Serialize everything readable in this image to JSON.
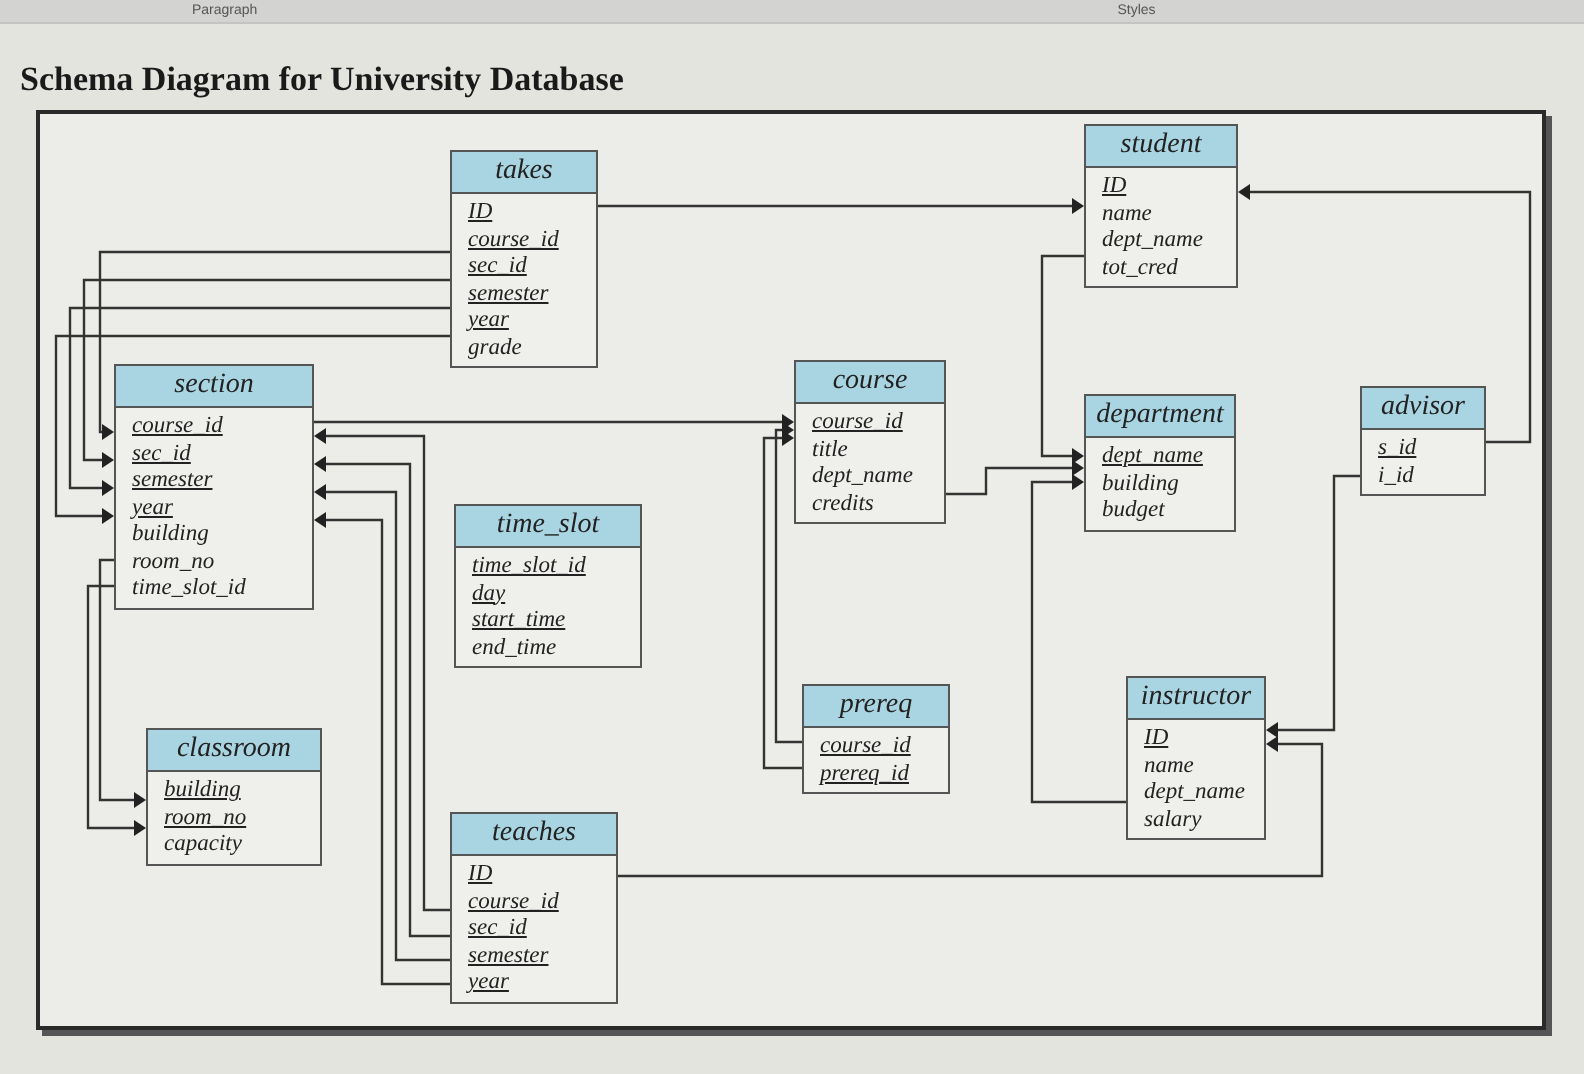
{
  "toolbar": {
    "labels": [
      "Paragraph",
      "Styles"
    ]
  },
  "title": "Schema Diagram for University Database",
  "tables": [
    {
      "name": "takes",
      "attributes": [
        {
          "name": "ID",
          "primary_key": true
        },
        {
          "name": "course_id",
          "primary_key": true
        },
        {
          "name": "sec_id",
          "primary_key": true
        },
        {
          "name": "semester",
          "primary_key": true
        },
        {
          "name": "year",
          "primary_key": true
        },
        {
          "name": "grade",
          "primary_key": false
        }
      ]
    },
    {
      "name": "student",
      "attributes": [
        {
          "name": "ID",
          "primary_key": true
        },
        {
          "name": "name",
          "primary_key": false
        },
        {
          "name": "dept_name",
          "primary_key": false
        },
        {
          "name": "tot_cred",
          "primary_key": false
        }
      ]
    },
    {
      "name": "section",
      "attributes": [
        {
          "name": "course_id",
          "primary_key": true
        },
        {
          "name": "sec_id",
          "primary_key": true
        },
        {
          "name": "semester",
          "primary_key": true
        },
        {
          "name": "year",
          "primary_key": true
        },
        {
          "name": "building",
          "primary_key": false
        },
        {
          "name": "room_no",
          "primary_key": false
        },
        {
          "name": "time_slot_id",
          "primary_key": false
        }
      ]
    },
    {
      "name": "course",
      "attributes": [
        {
          "name": "course_id",
          "primary_key": true
        },
        {
          "name": "title",
          "primary_key": false
        },
        {
          "name": "dept_name",
          "primary_key": false
        },
        {
          "name": "credits",
          "primary_key": false
        }
      ]
    },
    {
      "name": "department",
      "attributes": [
        {
          "name": "dept_name",
          "primary_key": true
        },
        {
          "name": "building",
          "primary_key": false
        },
        {
          "name": "budget",
          "primary_key": false
        }
      ]
    },
    {
      "name": "advisor",
      "attributes": [
        {
          "name": "s_id",
          "primary_key": true
        },
        {
          "name": "i_id",
          "primary_key": false
        }
      ]
    },
    {
      "name": "time_slot",
      "attributes": [
        {
          "name": "time_slot_id",
          "primary_key": true
        },
        {
          "name": "day",
          "primary_key": true
        },
        {
          "name": "start_time",
          "primary_key": true
        },
        {
          "name": "end_time",
          "primary_key": false
        }
      ]
    },
    {
      "name": "prereq",
      "attributes": [
        {
          "name": "course_id",
          "primary_key": true
        },
        {
          "name": "prereq_id",
          "primary_key": true
        }
      ]
    },
    {
      "name": "instructor",
      "attributes": [
        {
          "name": "ID",
          "primary_key": true
        },
        {
          "name": "name",
          "primary_key": false
        },
        {
          "name": "dept_name",
          "primary_key": false
        },
        {
          "name": "salary",
          "primary_key": false
        }
      ]
    },
    {
      "name": "classroom",
      "attributes": [
        {
          "name": "building",
          "primary_key": true
        },
        {
          "name": "room_no",
          "primary_key": true
        },
        {
          "name": "capacity",
          "primary_key": false
        }
      ]
    },
    {
      "name": "teaches",
      "attributes": [
        {
          "name": "ID",
          "primary_key": true
        },
        {
          "name": "course_id",
          "primary_key": true
        },
        {
          "name": "sec_id",
          "primary_key": true
        },
        {
          "name": "semester",
          "primary_key": true
        },
        {
          "name": "year",
          "primary_key": true
        }
      ]
    }
  ]
}
